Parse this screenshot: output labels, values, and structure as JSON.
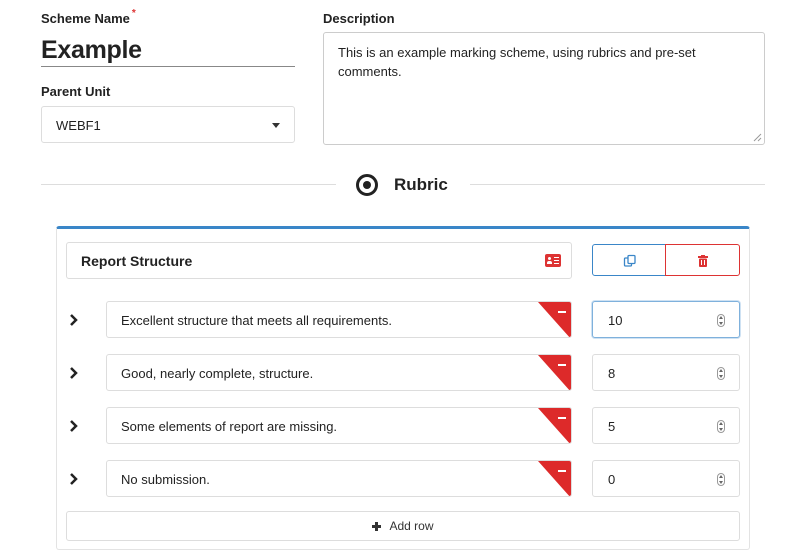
{
  "form": {
    "scheme_name_label": "Scheme Name",
    "required_mark": "*",
    "scheme_name_value": "Example",
    "parent_unit_label": "Parent Unit",
    "parent_unit_value": "WEBF1",
    "description_label": "Description",
    "description_value": "This is an example marking scheme, using rubrics and pre-set comments."
  },
  "rubric": {
    "title": "Rubric",
    "icon": "dot-circle-icon",
    "accent_color": "#3a86c8",
    "danger_color": "#dd2a2a",
    "criterion": {
      "name": "Report Structure",
      "icons": [
        "id-card-icon",
        "copy-icon",
        "trash-icon"
      ]
    },
    "rows": [
      {
        "text": "Excellent structure that meets all requirements.",
        "score": "10",
        "focused": true
      },
      {
        "text": "Good, nearly complete, structure.",
        "score": "8",
        "focused": false
      },
      {
        "text": "Some elements of report are missing.",
        "score": "5",
        "focused": false
      },
      {
        "text": "No submission.",
        "score": "0",
        "focused": false
      }
    ],
    "add_row_label": "Add row"
  }
}
